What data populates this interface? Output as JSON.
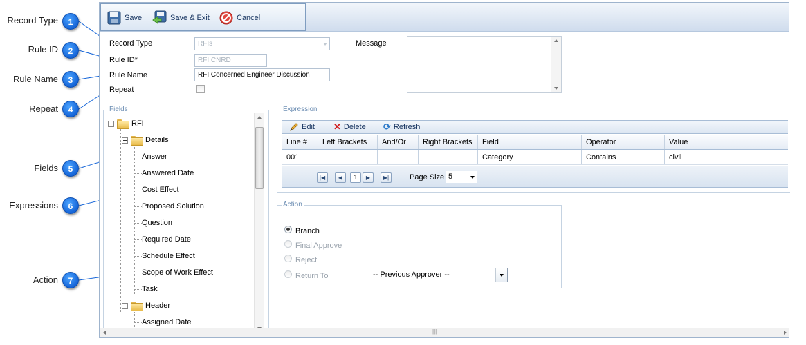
{
  "callouts": [
    {
      "number": "1",
      "label": "Record Type"
    },
    {
      "number": "2",
      "label": "Rule ID"
    },
    {
      "number": "3",
      "label": "Rule Name"
    },
    {
      "number": "4",
      "label": "Repeat"
    },
    {
      "number": "5",
      "label": "Fields"
    },
    {
      "number": "6",
      "label": "Expressions"
    },
    {
      "number": "7",
      "label": "Action"
    }
  ],
  "toolbar": {
    "save_label": "Save",
    "save_exit_label": "Save & Exit",
    "cancel_label": "Cancel"
  },
  "form": {
    "record_type_label": "Record Type",
    "record_type_value": "RFIs",
    "rule_id_label": "Rule ID*",
    "rule_id_value": "RFI CNRD",
    "rule_name_label": "Rule Name",
    "rule_name_value": "RFI Concerned Engineer Discussion",
    "repeat_label": "Repeat",
    "repeat_checked": false,
    "message_label": "Message",
    "message_value": ""
  },
  "fields": {
    "legend": "Fields",
    "root": "RFI",
    "groups": [
      {
        "name": "Details",
        "items": [
          "Answer",
          "Answered Date",
          "Cost Effect",
          "Proposed Solution",
          "Question",
          "Required Date",
          "Schedule Effect",
          "Scope of Work Effect",
          "Task"
        ]
      },
      {
        "name": "Header",
        "items": [
          "Assigned Date"
        ]
      }
    ]
  },
  "expression": {
    "legend": "Expression",
    "toolbar": {
      "edit_label": "Edit",
      "delete_label": "Delete",
      "refresh_label": "Refresh"
    },
    "columns": [
      "Line #",
      "Left Brackets",
      "And/Or",
      "Right Brackets",
      "Field",
      "Operator",
      "Value"
    ],
    "rows": [
      [
        "001",
        "",
        "",
        "",
        "Category",
        "Contains",
        "civil"
      ]
    ],
    "pager": {
      "page": "1",
      "page_size_label": "Page Size",
      "page_size": "5"
    }
  },
  "action": {
    "legend": "Action",
    "options": [
      {
        "label": "Branch",
        "selected": true,
        "enabled": true
      },
      {
        "label": "Final Approve",
        "selected": false,
        "enabled": false
      },
      {
        "label": "Reject",
        "selected": false,
        "enabled": false
      },
      {
        "label": "Return To",
        "selected": false,
        "enabled": false
      }
    ],
    "return_to_value": "-- Previous Approver --"
  },
  "colors": {
    "accent": "#1565d8",
    "legend": "#6e8fb4",
    "toolbar": "#dbe6f3"
  }
}
